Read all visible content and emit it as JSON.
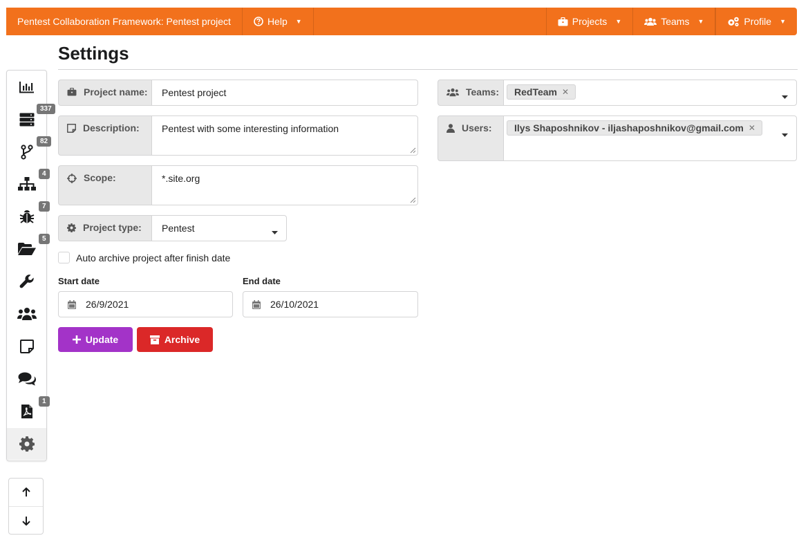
{
  "topbar": {
    "brand": "Pentest Collaboration Framework: Pentest project",
    "help": "Help",
    "projects": "Projects",
    "teams": "Teams",
    "profile": "Profile"
  },
  "page": {
    "title": "Settings"
  },
  "sidebar": {
    "items": [
      {
        "name": "dashboard",
        "icon": "chart-bar-icon",
        "badge": ""
      },
      {
        "name": "hosts",
        "icon": "server-icon",
        "badge": "337"
      },
      {
        "name": "ports",
        "icon": "code-branch-icon",
        "badge": "82"
      },
      {
        "name": "network",
        "icon": "sitemap-icon",
        "badge": "4"
      },
      {
        "name": "issues",
        "icon": "bug-icon",
        "badge": "7"
      },
      {
        "name": "files",
        "icon": "folder-open-icon",
        "badge": "5"
      },
      {
        "name": "tools",
        "icon": "wrench-icon",
        "badge": ""
      },
      {
        "name": "credentials",
        "icon": "users-icon",
        "badge": ""
      },
      {
        "name": "notes",
        "icon": "sticky-note-icon",
        "badge": ""
      },
      {
        "name": "chats",
        "icon": "comments-icon",
        "badge": ""
      },
      {
        "name": "reports",
        "icon": "file-pdf-icon",
        "badge": "1"
      },
      {
        "name": "settings",
        "icon": "cog-icon",
        "badge": ""
      }
    ]
  },
  "form": {
    "project_name": {
      "label": "Project name:",
      "value": "Pentest project"
    },
    "description": {
      "label": "Description:",
      "value": "Pentest with some interesting information"
    },
    "scope": {
      "label": "Scope:",
      "value": "*.site.org"
    },
    "project_type": {
      "label": "Project type:",
      "value": "Pentest"
    },
    "auto_archive": {
      "label": "Auto archive project after finish date",
      "checked": false
    },
    "start_date": {
      "label": "Start date",
      "value": "26/9/2021"
    },
    "end_date": {
      "label": "End date",
      "value": "26/10/2021"
    },
    "update_label": "Update",
    "archive_label": "Archive"
  },
  "right": {
    "teams": {
      "label": "Teams:",
      "tags": [
        "RedTeam"
      ]
    },
    "users": {
      "label": "Users:",
      "tags": [
        "Ilys Shaposhnikov - iljashaposhnikov@gmail.com"
      ]
    }
  },
  "colors": {
    "topbar": "#f2711c",
    "update": "#a333c8",
    "archive": "#db2828"
  }
}
